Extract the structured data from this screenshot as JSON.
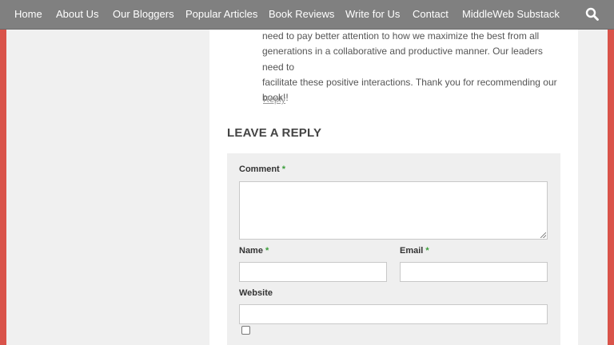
{
  "nav": {
    "items": [
      {
        "label": "Home"
      },
      {
        "label": "About Us"
      },
      {
        "label": "Our Bloggers"
      },
      {
        "label": "Popular Articles"
      },
      {
        "label": "Book Reviews"
      },
      {
        "label": "Write for Us"
      },
      {
        "label": "Contact"
      },
      {
        "label": "MiddleWeb Substack"
      }
    ],
    "search_icon": "search-icon"
  },
  "comment": {
    "lines": [
      "need to pay better attention to how we maximize the best from all",
      "generations in a collaborative and productive manner. Our leaders need to",
      "facilitate these positive interactions. Thank you for recommending our",
      "book!!"
    ],
    "reply_label": "Reply"
  },
  "reply_form": {
    "heading": "LEAVE A REPLY",
    "comment_label": "Comment",
    "name_label": "Name",
    "email_label": "Email",
    "website_label": "Website",
    "required_mark": "*",
    "comment_value": "",
    "name_value": "",
    "email_value": "",
    "website_value": ""
  },
  "colors": {
    "accent_red": "#d9534a",
    "nav_bg": "#808080",
    "required_green": "#3a9e3a"
  }
}
